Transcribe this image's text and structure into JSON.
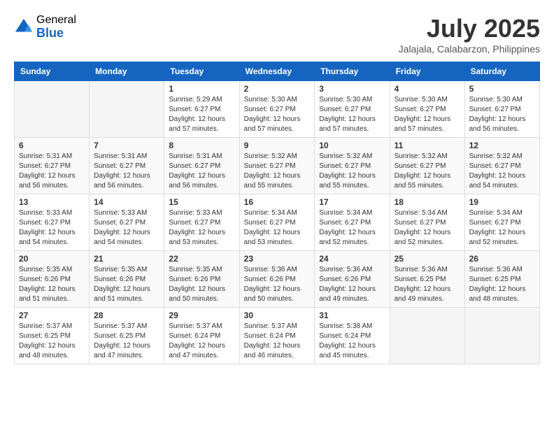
{
  "header": {
    "logo_general": "General",
    "logo_blue": "Blue",
    "month_year": "July 2025",
    "location": "Jalajala, Calabarzon, Philippines"
  },
  "columns": [
    "Sunday",
    "Monday",
    "Tuesday",
    "Wednesday",
    "Thursday",
    "Friday",
    "Saturday"
  ],
  "weeks": [
    [
      {
        "day": "",
        "info": ""
      },
      {
        "day": "",
        "info": ""
      },
      {
        "day": "1",
        "info": "Sunrise: 5:29 AM\nSunset: 6:27 PM\nDaylight: 12 hours\nand 57 minutes."
      },
      {
        "day": "2",
        "info": "Sunrise: 5:30 AM\nSunset: 6:27 PM\nDaylight: 12 hours\nand 57 minutes."
      },
      {
        "day": "3",
        "info": "Sunrise: 5:30 AM\nSunset: 6:27 PM\nDaylight: 12 hours\nand 57 minutes."
      },
      {
        "day": "4",
        "info": "Sunrise: 5:30 AM\nSunset: 6:27 PM\nDaylight: 12 hours\nand 57 minutes."
      },
      {
        "day": "5",
        "info": "Sunrise: 5:30 AM\nSunset: 6:27 PM\nDaylight: 12 hours\nand 56 minutes."
      }
    ],
    [
      {
        "day": "6",
        "info": "Sunrise: 5:31 AM\nSunset: 6:27 PM\nDaylight: 12 hours\nand 56 minutes."
      },
      {
        "day": "7",
        "info": "Sunrise: 5:31 AM\nSunset: 6:27 PM\nDaylight: 12 hours\nand 56 minutes."
      },
      {
        "day": "8",
        "info": "Sunrise: 5:31 AM\nSunset: 6:27 PM\nDaylight: 12 hours\nand 56 minutes."
      },
      {
        "day": "9",
        "info": "Sunrise: 5:32 AM\nSunset: 6:27 PM\nDaylight: 12 hours\nand 55 minutes."
      },
      {
        "day": "10",
        "info": "Sunrise: 5:32 AM\nSunset: 6:27 PM\nDaylight: 12 hours\nand 55 minutes."
      },
      {
        "day": "11",
        "info": "Sunrise: 5:32 AM\nSunset: 6:27 PM\nDaylight: 12 hours\nand 55 minutes."
      },
      {
        "day": "12",
        "info": "Sunrise: 5:32 AM\nSunset: 6:27 PM\nDaylight: 12 hours\nand 54 minutes."
      }
    ],
    [
      {
        "day": "13",
        "info": "Sunrise: 5:33 AM\nSunset: 6:27 PM\nDaylight: 12 hours\nand 54 minutes."
      },
      {
        "day": "14",
        "info": "Sunrise: 5:33 AM\nSunset: 6:27 PM\nDaylight: 12 hours\nand 54 minutes."
      },
      {
        "day": "15",
        "info": "Sunrise: 5:33 AM\nSunset: 6:27 PM\nDaylight: 12 hours\nand 53 minutes."
      },
      {
        "day": "16",
        "info": "Sunrise: 5:34 AM\nSunset: 6:27 PM\nDaylight: 12 hours\nand 53 minutes."
      },
      {
        "day": "17",
        "info": "Sunrise: 5:34 AM\nSunset: 6:27 PM\nDaylight: 12 hours\nand 52 minutes."
      },
      {
        "day": "18",
        "info": "Sunrise: 5:34 AM\nSunset: 6:27 PM\nDaylight: 12 hours\nand 52 minutes."
      },
      {
        "day": "19",
        "info": "Sunrise: 5:34 AM\nSunset: 6:27 PM\nDaylight: 12 hours\nand 52 minutes."
      }
    ],
    [
      {
        "day": "20",
        "info": "Sunrise: 5:35 AM\nSunset: 6:26 PM\nDaylight: 12 hours\nand 51 minutes."
      },
      {
        "day": "21",
        "info": "Sunrise: 5:35 AM\nSunset: 6:26 PM\nDaylight: 12 hours\nand 51 minutes."
      },
      {
        "day": "22",
        "info": "Sunrise: 5:35 AM\nSunset: 6:26 PM\nDaylight: 12 hours\nand 50 minutes."
      },
      {
        "day": "23",
        "info": "Sunrise: 5:36 AM\nSunset: 6:26 PM\nDaylight: 12 hours\nand 50 minutes."
      },
      {
        "day": "24",
        "info": "Sunrise: 5:36 AM\nSunset: 6:26 PM\nDaylight: 12 hours\nand 49 minutes."
      },
      {
        "day": "25",
        "info": "Sunrise: 5:36 AM\nSunset: 6:25 PM\nDaylight: 12 hours\nand 49 minutes."
      },
      {
        "day": "26",
        "info": "Sunrise: 5:36 AM\nSunset: 6:25 PM\nDaylight: 12 hours\nand 48 minutes."
      }
    ],
    [
      {
        "day": "27",
        "info": "Sunrise: 5:37 AM\nSunset: 6:25 PM\nDaylight: 12 hours\nand 48 minutes."
      },
      {
        "day": "28",
        "info": "Sunrise: 5:37 AM\nSunset: 6:25 PM\nDaylight: 12 hours\nand 47 minutes."
      },
      {
        "day": "29",
        "info": "Sunrise: 5:37 AM\nSunset: 6:24 PM\nDaylight: 12 hours\nand 47 minutes."
      },
      {
        "day": "30",
        "info": "Sunrise: 5:37 AM\nSunset: 6:24 PM\nDaylight: 12 hours\nand 46 minutes."
      },
      {
        "day": "31",
        "info": "Sunrise: 5:38 AM\nSunset: 6:24 PM\nDaylight: 12 hours\nand 45 minutes."
      },
      {
        "day": "",
        "info": ""
      },
      {
        "day": "",
        "info": ""
      }
    ]
  ]
}
